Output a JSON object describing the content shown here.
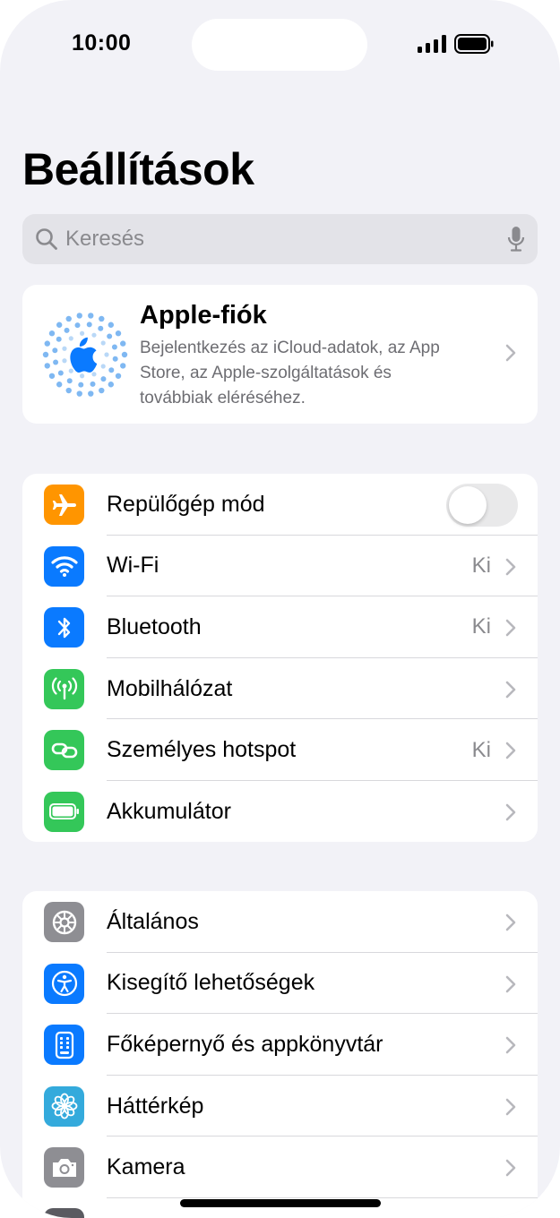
{
  "status": {
    "time": "10:00"
  },
  "page": {
    "title": "Beállítások"
  },
  "search": {
    "placeholder": "Keresés"
  },
  "account": {
    "title": "Apple-fiók",
    "description_lines": [
      "Bejelentkezés az iCloud-adatok, az App",
      "Store, az Apple-szolgáltatások és",
      "továbbiak eléréséhez."
    ]
  },
  "connectivity": [
    {
      "label": "Repülőgép mód",
      "icon": "airplane-icon",
      "color": "#ff9500",
      "toggle": false
    },
    {
      "label": "Wi-Fi",
      "icon": "wifi-icon",
      "color": "#0a7aff",
      "value": "Ki"
    },
    {
      "label": "Bluetooth",
      "icon": "bluetooth-icon",
      "color": "#0a7aff",
      "value": "Ki"
    },
    {
      "label": "Mobilhálózat",
      "icon": "antenna-icon",
      "color": "#34c759",
      "value": ""
    },
    {
      "label": "Személyes hotspot",
      "icon": "hotspot-link-icon",
      "color": "#34c759",
      "value": "Ki"
    },
    {
      "label": "Akkumulátor",
      "icon": "battery-icon",
      "color": "#34c759",
      "value": ""
    }
  ],
  "general": [
    {
      "label": "Általános",
      "icon": "gear-icon",
      "color": "#8e8e93"
    },
    {
      "label": "Kisegítő lehetőségek",
      "icon": "accessibility-icon",
      "color": "#0a7aff"
    },
    {
      "label": "Főképernyő és appkönyvtár",
      "icon": "home-screen-icon",
      "color": "#0a7aff"
    },
    {
      "label": "Háttérkép",
      "icon": "flower-icon",
      "color": "#34aadc"
    },
    {
      "label": "Kamera",
      "icon": "camera-icon",
      "color": "#8e8e93"
    }
  ]
}
